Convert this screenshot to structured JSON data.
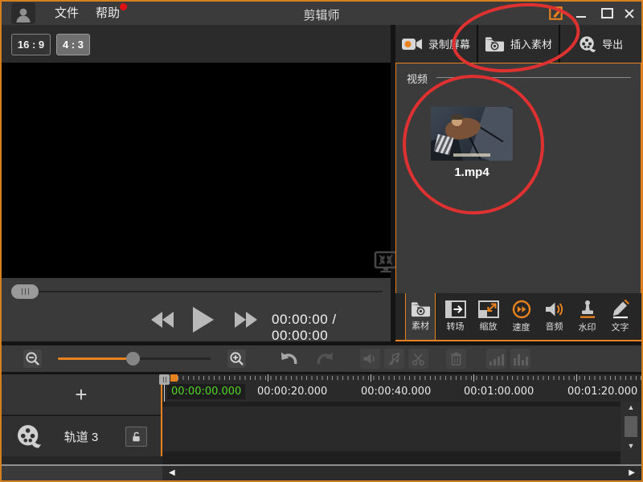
{
  "window": {
    "title": "剪辑师"
  },
  "menubar": {
    "file": "文件",
    "help": "帮助"
  },
  "aspect_bar": {
    "wide": "16 : 9",
    "standard": "4 : 3"
  },
  "top_actions": {
    "record": "录制屏幕",
    "insert": "插入素材",
    "export": "导出"
  },
  "library": {
    "section_header": "视频",
    "items": [
      {
        "name": "1.mp4"
      }
    ]
  },
  "media_tabs": [
    {
      "label": "素材"
    },
    {
      "label": "转场"
    },
    {
      "label": "缩放"
    },
    {
      "label": "速度"
    },
    {
      "label": "音频"
    },
    {
      "label": "水印"
    },
    {
      "label": "文字"
    }
  ],
  "player": {
    "timecode": "00:00:00 / 00:00:00"
  },
  "timeline": {
    "current_time": "00:00:00.000",
    "ruler_ticks": [
      "00:00:20.000",
      "00:00:40.000",
      "00:01:00.000",
      "00:01:20.000"
    ],
    "add_track_label": "+",
    "track": {
      "label": "轨道 3"
    }
  },
  "glyphs": {
    "scroll_left": "◀",
    "scroll_right": "▶",
    "scroll_up": "▲",
    "scroll_down": "▼"
  },
  "colors": {
    "accent_orange": "#e8821e",
    "annotation_red": "#e03131",
    "timecode_green": "#52d726"
  }
}
